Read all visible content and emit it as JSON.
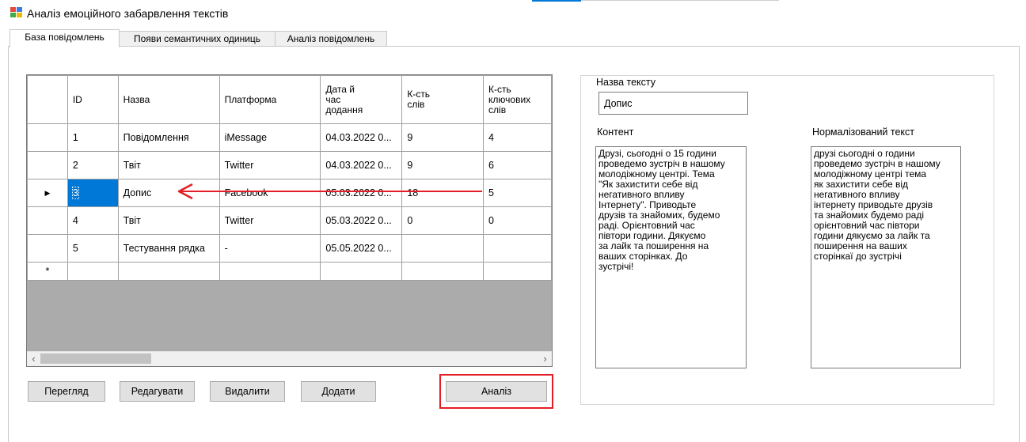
{
  "window": {
    "title": "Аналіз емоційного забарвлення текстів"
  },
  "tabs": [
    {
      "label": "База повідомлень",
      "active": true
    },
    {
      "label": "Появи семантичних одиниць",
      "active": false
    },
    {
      "label": "Аналіз повідомлень",
      "active": false
    }
  ],
  "grid": {
    "columns": [
      "ID",
      "Назва",
      "Платформа",
      "Дата й\nчас\nдодання",
      "К-сть\nслів",
      "К-сть\nключових\nслів"
    ],
    "rows": [
      {
        "marker": "",
        "id": "1",
        "name": "Повідомлення",
        "platform": "iMessage",
        "date": "04.03.2022 0...",
        "words": "9",
        "keywords": "4"
      },
      {
        "marker": "",
        "id": "2",
        "name": "Твіт",
        "platform": "Twitter",
        "date": "04.03.2022 0...",
        "words": "9",
        "keywords": "6"
      },
      {
        "marker": "▶",
        "id": "3",
        "name": "Допис",
        "platform": "Facebook",
        "date": "05.03.2022 0...",
        "words": "18",
        "keywords": "5"
      },
      {
        "marker": "",
        "id": "4",
        "name": "Твіт",
        "platform": "Twitter",
        "date": "05.03.2022 0...",
        "words": "0",
        "keywords": "0"
      },
      {
        "marker": "",
        "id": "5",
        "name": "Тестування рядка",
        "platform": "-",
        "date": "05.05.2022 0...",
        "words": "",
        "keywords": ""
      }
    ],
    "new_row_marker": "*",
    "selected_row": 3
  },
  "buttons": {
    "view": "Перегляд",
    "edit": "Редагувати",
    "delete": "Видалити",
    "add": "Додати",
    "analyze": "Аналіз"
  },
  "details": {
    "name_label": "Назва тексту",
    "name_value": "Допис",
    "content_label": "Контент",
    "content_text": "Друзі, сьогодні о 15 години\nпроведемо зустріч в нашому\nмолодіжному центрі. Тема\n\"Як захистити себе від\nнегативного впливу\nІнтернету\". Приводьте\nдрузів та знайомих, будемо\nраді. Орієнтовний час\nпівтори години. Дякуємо\nза лайк та поширення на\nваших сторінках. До\nзустрічі!",
    "normalized_label": "Нормалізований текст",
    "normalized_text": "друзі сьогодні о години\nпроведемо зустріч в нашому\nмолодіжному центрі тема\nяк захистити себе від\nнегативного впливу\nінтернету приводьте друзів\nта знайомих будемо раді\nорієнтовний час півтори\nгодини дякуємо за лайк та\nпоширення на ваших\nсторінкаї до зустрічі"
  },
  "colors": {
    "selection": "#0078d7",
    "annotation_red": "#e41e26"
  }
}
